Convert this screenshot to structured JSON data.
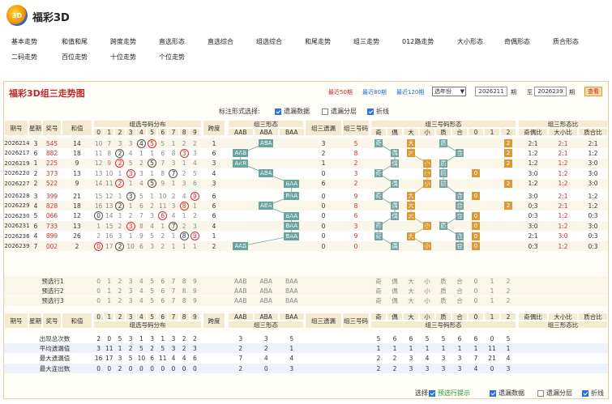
{
  "brand": {
    "title": "福彩3D",
    "logo_text": "3D"
  },
  "nav": [
    "基本走势",
    "和值和尾",
    "跨度走势",
    "直选形态",
    "直选综合",
    "组选综合",
    "和尾走势",
    "组三走势",
    "012路走势",
    "大小形态",
    "奇偶形态",
    "质合形态",
    "二码走势",
    "百位走势",
    "十位走势",
    "个位走势"
  ],
  "panel": {
    "title": "福彩3D组三走势图",
    "links": [
      "最近50期",
      "最近80期",
      "最近120期"
    ],
    "select": "选年份",
    "from": "2026211",
    "mid1": "期",
    "to_label": "至",
    "to": "2026239",
    "mid2": "期",
    "query": "查看",
    "options_label": "标注形式选择:",
    "opts": [
      {
        "label": "遗漏数据",
        "on": true
      },
      {
        "label": "遗漏分层",
        "on": false
      },
      {
        "label": "折线",
        "on": true
      }
    ]
  },
  "headers": {
    "issue": "期号",
    "week": "星期",
    "prize": "奖号",
    "sum": "和值",
    "dist": "组选号码分布",
    "digits": [
      "0",
      "1",
      "2",
      "3",
      "4",
      "5",
      "6",
      "7",
      "8",
      "9"
    ],
    "span": "跨度",
    "form": "组三形态",
    "forms": [
      "AAB",
      "ABA",
      "BAA"
    ],
    "miss": "组三遗漏",
    "code": "组三号码",
    "shape": "组三号码形态",
    "shapes": [
      "奇",
      "偶",
      "大",
      "小",
      "质",
      "合",
      "0",
      "1",
      "2"
    ],
    "ratio": "组三形态比",
    "ratios": [
      "奇偶比",
      "大小比",
      "质合比"
    ]
  },
  "rows": [
    {
      "issue": "2026214",
      "week": "3",
      "prize": "545",
      "sum": "14",
      "dist": [
        "10",
        "7",
        "3",
        "3",
        "4",
        "5",
        "5",
        "1",
        "2",
        "2"
      ],
      "span": "1",
      "form": "ABA",
      "miss": "3",
      "code": "5",
      "r": [
        "2:1",
        "2:1",
        "2:1"
      ]
    },
    {
      "issue": "2026217",
      "week": "6",
      "prize": "882",
      "sum": "18",
      "dist": [
        "11",
        "8",
        "2",
        "4",
        "1",
        "1",
        "6",
        "8",
        "3",
        "3"
      ],
      "span": "6",
      "form": "AAB",
      "miss": "2",
      "code": "8",
      "r": [
        "1:2",
        "2:1",
        "1:2"
      ]
    },
    {
      "issue": "2026219",
      "week": "1",
      "prize": "225",
      "sum": "9",
      "dist": [
        "12",
        "9",
        "2",
        "5",
        "2",
        "5",
        "7",
        "3",
        "1",
        "4"
      ],
      "span": "3",
      "form": "AAB",
      "miss": "1",
      "code": "2",
      "r": [
        "1:2",
        "1:2",
        "3:0"
      ]
    },
    {
      "issue": "2026220",
      "week": "2",
      "prize": "373",
      "sum": "13",
      "dist": [
        "13",
        "10",
        "1",
        "3",
        "3",
        "1",
        "8",
        "7",
        "2",
        "5"
      ],
      "span": "4",
      "form": "ABA",
      "miss": "0",
      "code": "3",
      "r": [
        "3:0",
        "1:2",
        "3:0"
      ]
    },
    {
      "issue": "2026227",
      "week": "2",
      "prize": "522",
      "sum": "9",
      "dist": [
        "14",
        "11",
        "2",
        "1",
        "4",
        "5",
        "9",
        "1",
        "3",
        "6"
      ],
      "span": "3",
      "form": "BAA",
      "miss": "6",
      "code": "2",
      "r": [
        "1:2",
        "1:2",
        "3:0"
      ]
    },
    {
      "issue": "2026228",
      "week": "3",
      "prize": "399",
      "sum": "21",
      "dist": [
        "15",
        "12",
        "1",
        "3",
        "5",
        "1",
        "10",
        "2",
        "4",
        "9"
      ],
      "span": "6",
      "form": "BAA",
      "miss": "0",
      "code": "9",
      "r": [
        "3:0",
        "2:1",
        "1:2"
      ]
    },
    {
      "issue": "2026229",
      "week": "4",
      "prize": "828",
      "sum": "18",
      "dist": [
        "16",
        "13",
        "2",
        "1",
        "6",
        "2",
        "11",
        "3",
        "8",
        "1"
      ],
      "span": "6",
      "form": "ABA",
      "miss": "0",
      "code": "8",
      "r": [
        "0:3",
        "2:1",
        "1:2"
      ]
    },
    {
      "issue": "2026230",
      "week": "5",
      "prize": "066",
      "sum": "12",
      "dist": [
        "0",
        "14",
        "1",
        "2",
        "7",
        "3",
        "6",
        "4",
        "1",
        "2"
      ],
      "span": "6",
      "form": "BAA",
      "miss": "0",
      "code": "6",
      "r": [
        "0:3",
        "1:2",
        "0:3"
      ]
    },
    {
      "issue": "2026231",
      "week": "6",
      "prize": "733",
      "sum": "13",
      "dist": [
        "1",
        "15",
        "2",
        "3",
        "8",
        "4",
        "1",
        "7",
        "2",
        "3"
      ],
      "span": "4",
      "form": "BAA",
      "miss": "0",
      "code": "3",
      "r": [
        "3:0",
        "1:2",
        "3:0"
      ]
    },
    {
      "issue": "2026236",
      "week": "4",
      "prize": "899",
      "sum": "26",
      "dist": [
        "2",
        "16",
        "3",
        "1",
        "9",
        "5",
        "2",
        "1",
        "8",
        "9"
      ],
      "span": "1",
      "form": "BAA",
      "miss": "0",
      "code": "9",
      "r": [
        "2:1",
        "3:0",
        "0:3"
      ]
    },
    {
      "issue": "2026239",
      "week": "7",
      "prize": "002",
      "sum": "2",
      "dist": [
        "0",
        "17",
        "2",
        "10",
        "6",
        "3",
        "2",
        "1",
        "1",
        "1"
      ],
      "span": "2",
      "form": "AAB",
      "miss": "0",
      "code": "0",
      "r": [
        "0:3",
        "1:2",
        "0:3"
      ]
    }
  ],
  "pre": [
    "预选行1",
    "预选行2",
    "预选行3"
  ],
  "stats": [
    {
      "label": "出现总次数",
      "v": [
        "2",
        "0",
        "5",
        "3",
        "1",
        "3",
        "1",
        "3",
        "2",
        "2"
      ],
      "f": [
        "3",
        "3",
        "5"
      ],
      "s": [
        "5",
        "6",
        "6",
        "5",
        "5",
        "6",
        "6",
        "0",
        "5"
      ]
    },
    {
      "label": "平均遗漏值",
      "v": [
        "3",
        "11",
        "1",
        "2",
        "5",
        "2",
        "5",
        "3",
        "2",
        "3"
      ],
      "f": [
        "2",
        "2",
        "1"
      ],
      "s": [
        "1",
        "1",
        "1",
        "1",
        "1",
        "1",
        "1",
        "11",
        "1"
      ]
    },
    {
      "label": "最大遗漏值",
      "v": [
        "16",
        "17",
        "3",
        "5",
        "10",
        "6",
        "11",
        "4",
        "4",
        "6"
      ],
      "f": [
        "7",
        "4",
        "4"
      ],
      "s": [
        "2",
        "2",
        "3",
        "4",
        "3",
        "3",
        "7",
        "21",
        "4"
      ]
    },
    {
      "label": "最大连出数",
      "v": [
        "0",
        "0",
        "2",
        "0",
        "0",
        "0",
        "0",
        "0",
        "0",
        "0"
      ],
      "f": [
        "2",
        "0",
        "3"
      ],
      "s": [
        "2",
        "2",
        "3",
        "3",
        "3",
        "3",
        "4",
        "0",
        "3"
      ]
    }
  ],
  "bottom": {
    "label": "选择:",
    "opts": [
      {
        "label": "预选行提示",
        "on": true
      },
      {
        "label": "遗漏数据",
        "on": true
      },
      {
        "label": "遗漏分层",
        "on": false
      },
      {
        "label": "折线",
        "on": true
      }
    ]
  }
}
